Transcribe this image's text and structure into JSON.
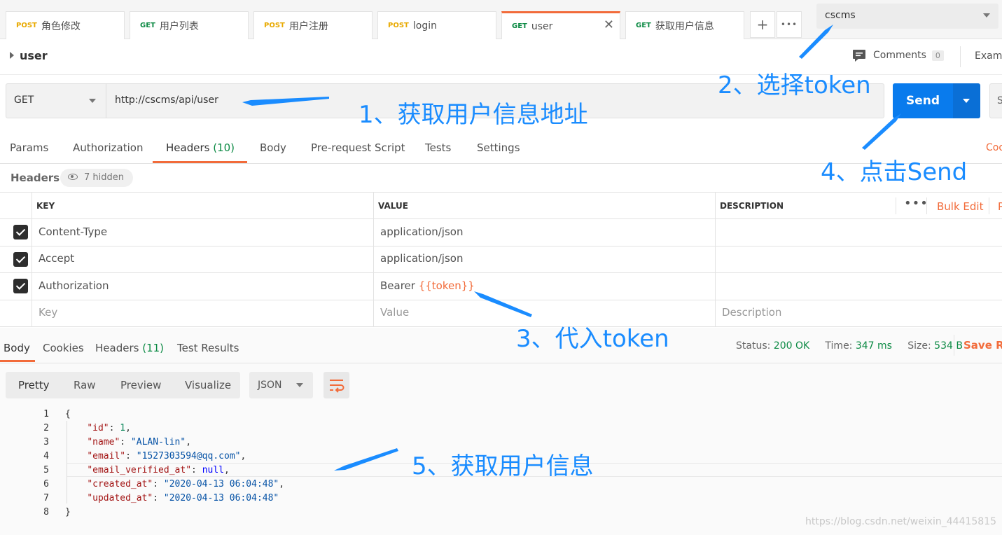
{
  "tabs": [
    {
      "method": "POST",
      "label": "角色修改"
    },
    {
      "method": "GET",
      "label": "用户列表"
    },
    {
      "method": "POST",
      "label": "用户注册"
    },
    {
      "method": "POST",
      "label": "login"
    },
    {
      "method": "GET",
      "label": "user",
      "active": true
    },
    {
      "method": "GET",
      "label": "获取用户信息"
    }
  ],
  "tab_actions": {
    "new": "+",
    "more": "•••",
    "close": "✕"
  },
  "environment": {
    "selected": "cscms"
  },
  "request": {
    "title": "user",
    "comments_label": "Comments",
    "comments_count": "0",
    "examples_label": "Exam",
    "method": "GET",
    "url": "http://cscms/api/user",
    "send_label": "Send",
    "save_label": "S"
  },
  "request_tabs": [
    {
      "label": "Params"
    },
    {
      "label": "Authorization"
    },
    {
      "label": "Headers",
      "count": "(10)",
      "selected": true
    },
    {
      "label": "Body"
    },
    {
      "label": "Pre-request Script"
    },
    {
      "label": "Tests"
    },
    {
      "label": "Settings"
    }
  ],
  "cookies_link": "Coo",
  "headers_section": {
    "title": "Headers",
    "hidden": "7 hidden",
    "columns": [
      "KEY",
      "VALUE",
      "DESCRIPTION"
    ],
    "more": "•••",
    "bulk_edit": "Bulk Edit",
    "cut_link": "P",
    "rows": [
      {
        "checked": true,
        "key": "Content-Type",
        "value": "application/json",
        "description": ""
      },
      {
        "checked": true,
        "key": "Accept",
        "value": "application/json",
        "description": ""
      },
      {
        "checked": true,
        "key": "Authorization",
        "value_prefix": "Bearer ",
        "value_var": "{{token}}",
        "description": ""
      }
    ],
    "placeholder": {
      "key": "Key",
      "value": "Value",
      "description": "Description"
    }
  },
  "response": {
    "tabs": [
      {
        "label": "Body",
        "selected": true
      },
      {
        "label": "Cookies"
      },
      {
        "label": "Headers",
        "count": "(11)"
      },
      {
        "label": "Test Results"
      }
    ],
    "status_label": "Status:",
    "status": "200 OK",
    "time_label": "Time:",
    "time": "347 ms",
    "size_label": "Size:",
    "size": "534 B",
    "save_label": "Save Re",
    "views": [
      "Pretty",
      "Raw",
      "Preview",
      "Visualize"
    ],
    "format": "JSON",
    "code_lines": [
      {
        "n": "1",
        "text": "{"
      },
      {
        "n": "2",
        "key": "\"id\"",
        "val": "1",
        "vtype": "n",
        "comma": ","
      },
      {
        "n": "3",
        "key": "\"name\"",
        "val": "\"ALAN-lin\"",
        "vtype": "s",
        "comma": ","
      },
      {
        "n": "4",
        "key": "\"email\"",
        "val": "\"1527303594@qq.com\"",
        "vtype": "s",
        "comma": ","
      },
      {
        "n": "5",
        "key": "\"email_verified_at\"",
        "val": "null",
        "vtype": "b",
        "comma": ","
      },
      {
        "n": "6",
        "key": "\"created_at\"",
        "val": "\"2020-04-13 06:04:48\"",
        "vtype": "s",
        "comma": ","
      },
      {
        "n": "7",
        "key": "\"updated_at\"",
        "val": "\"2020-04-13 06:04:48\"",
        "vtype": "s",
        "comma": ""
      },
      {
        "n": "8",
        "text": "}"
      }
    ]
  },
  "annotations": {
    "a1": "1、获取用户信息地址",
    "a2": "2、选择token",
    "a3": "3、代入token",
    "a4": "4、点击Send",
    "a5": "5、获取用户信息",
    "color": "#1a8cff"
  },
  "watermark": "https://blog.csdn.net/weixin_44415815",
  "colors": {
    "accent": "#f26b3a",
    "send": "#097bed",
    "post": "#e8a900",
    "get": "#0c8a44"
  }
}
